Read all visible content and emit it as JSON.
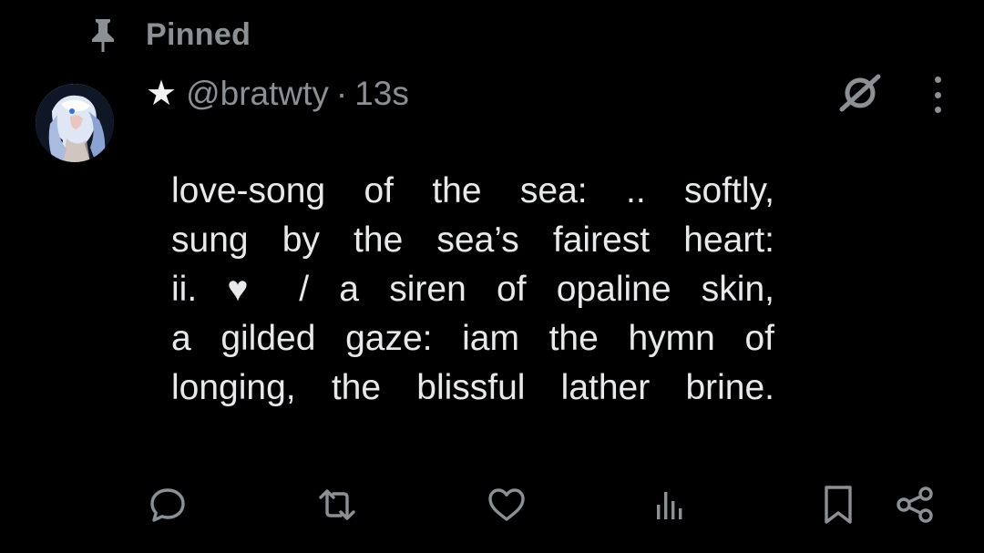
{
  "pinned": {
    "label": "Pinned",
    "icon": "pin-icon"
  },
  "post": {
    "author_badge_icon": "star-icon",
    "author_badge": "★",
    "handle": "@bratwty",
    "separator": "·",
    "timestamp": "13s",
    "avatar_icon": "avatar",
    "body_lines": [
      "love-song of the sea:  .. softly,",
      "sung by the sea’s fairest heart:",
      "ii. ♥  / a siren of opaline skin,",
      "a gilded gaze: iam the hymn of",
      "longing, the blissful lather brine."
    ]
  },
  "top_icons": {
    "grok": "grok-icon",
    "more": "more-options-icon"
  },
  "actions": [
    {
      "name": "reply-icon"
    },
    {
      "name": "repost-icon"
    },
    {
      "name": "like-icon"
    },
    {
      "name": "views-icon"
    },
    {
      "name": "bookmark-icon"
    },
    {
      "name": "share-icon"
    }
  ],
  "colors": {
    "background": "#000000",
    "text_primary": "#e7e9ea",
    "text_secondary": "#8b9095"
  }
}
